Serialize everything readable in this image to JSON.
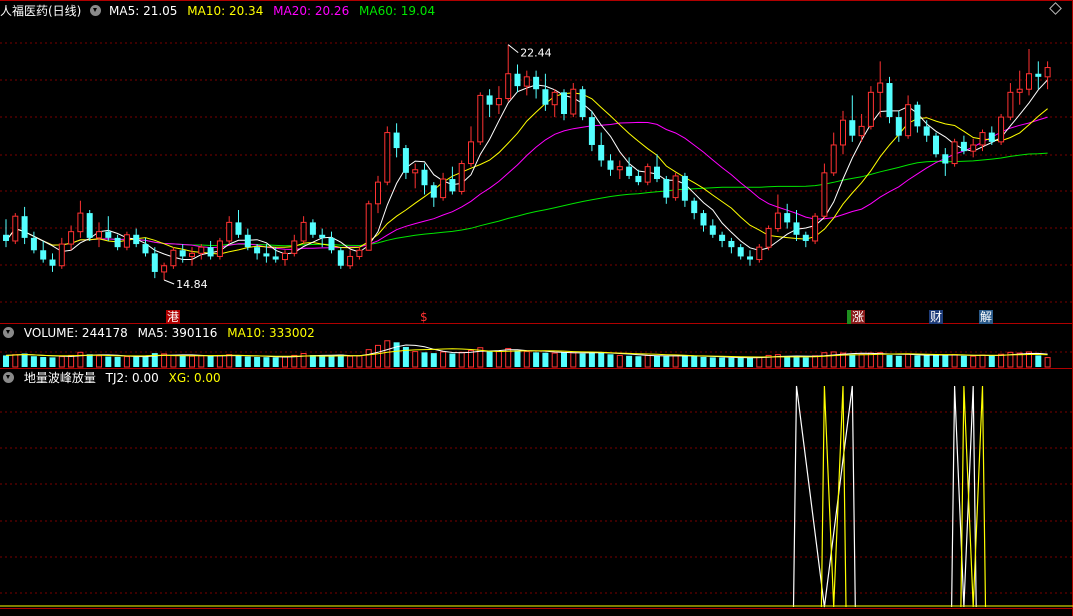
{
  "main_header": {
    "title": "人福医药(日线)",
    "ma5": "MA5: 21.05",
    "ma10": "MA10: 20.34",
    "ma20": "MA20: 20.26",
    "ma60": "MA60: 19.04"
  },
  "volume_header": {
    "label": "VOLUME: 244178",
    "ma5": "MA5: 390116",
    "ma10": "MA10: 333002"
  },
  "indicator_header": {
    "name": "地量波峰放量",
    "tj2": "TJ2: 0.00",
    "xg": "XG: 0.00"
  },
  "event_labels": {
    "e1": "港",
    "e2": "$",
    "e3": "涨",
    "e4": "财",
    "e5": "解"
  },
  "colors": {
    "up": "#ff3232",
    "down": "#54ffff",
    "ma5": "#ffffff",
    "ma10": "#ffff00",
    "ma20": "#ff00ff",
    "ma60": "#00e600",
    "grid": "#7a0000",
    "tj2": "#ffffff",
    "xg": "#ffff00"
  },
  "chart_data": [
    {
      "type": "candlestick",
      "ohlc": [
        [
          16.3,
          16.8,
          15.9,
          16.1
        ],
        [
          16.1,
          17.0,
          16.0,
          16.9
        ],
        [
          16.9,
          17.2,
          16.0,
          16.2
        ],
        [
          16.2,
          16.4,
          15.7,
          15.8
        ],
        [
          15.8,
          16.1,
          15.4,
          15.5
        ],
        [
          15.5,
          15.7,
          15.1,
          15.3
        ],
        [
          15.3,
          16.2,
          15.2,
          16.0
        ],
        [
          16.0,
          16.6,
          15.8,
          16.4
        ],
        [
          16.4,
          17.4,
          16.2,
          17.0
        ],
        [
          17.0,
          17.1,
          16.1,
          16.2
        ],
        [
          16.2,
          16.7,
          15.9,
          16.4
        ],
        [
          16.4,
          16.9,
          16.1,
          16.2
        ],
        [
          16.2,
          16.3,
          15.8,
          15.9
        ],
        [
          15.9,
          16.4,
          15.8,
          16.3
        ],
        [
          16.3,
          16.5,
          15.9,
          16.0
        ],
        [
          16.0,
          16.2,
          15.6,
          15.7
        ],
        [
          15.7,
          15.9,
          14.9,
          15.1
        ],
        [
          15.1,
          15.4,
          14.84,
          15.3
        ],
        [
          15.3,
          15.9,
          15.2,
          15.8
        ],
        [
          15.8,
          16.0,
          15.4,
          15.6
        ],
        [
          15.6,
          15.9,
          15.3,
          15.7
        ],
        [
          15.7,
          16.0,
          15.5,
          15.9
        ],
        [
          15.9,
          16.1,
          15.5,
          15.6
        ],
        [
          15.6,
          16.2,
          15.5,
          16.1
        ],
        [
          16.1,
          16.9,
          16.0,
          16.7
        ],
        [
          16.7,
          17.1,
          16.2,
          16.3
        ],
        [
          16.3,
          16.5,
          15.8,
          15.9
        ],
        [
          15.9,
          16.0,
          15.5,
          15.7
        ],
        [
          15.7,
          16.0,
          15.4,
          15.6
        ],
        [
          15.6,
          15.9,
          15.4,
          15.5
        ],
        [
          15.5,
          15.8,
          15.3,
          15.7
        ],
        [
          15.7,
          16.3,
          15.6,
          16.1
        ],
        [
          16.1,
          16.9,
          16.0,
          16.7
        ],
        [
          16.7,
          16.8,
          16.2,
          16.3
        ],
        [
          16.3,
          16.5,
          15.9,
          16.2
        ],
        [
          16.2,
          16.4,
          15.7,
          15.8
        ],
        [
          15.8,
          15.9,
          15.2,
          15.3
        ],
        [
          15.3,
          15.8,
          15.2,
          15.6
        ],
        [
          15.6,
          15.9,
          15.5,
          15.8
        ],
        [
          15.8,
          17.4,
          15.8,
          17.3
        ],
        [
          17.3,
          18.2,
          17.0,
          18.0
        ],
        [
          18.0,
          19.8,
          17.9,
          19.6
        ],
        [
          19.6,
          19.9,
          18.8,
          19.1
        ],
        [
          19.1,
          19.2,
          18.1,
          18.3
        ],
        [
          18.3,
          18.6,
          17.8,
          18.4
        ],
        [
          18.4,
          18.6,
          17.6,
          17.9
        ],
        [
          17.9,
          18.0,
          17.2,
          17.5
        ],
        [
          17.5,
          18.3,
          17.4,
          18.1
        ],
        [
          18.1,
          18.5,
          17.6,
          17.7
        ],
        [
          17.7,
          18.7,
          17.6,
          18.6
        ],
        [
          18.6,
          19.8,
          18.5,
          19.3
        ],
        [
          19.3,
          20.9,
          19.2,
          20.8
        ],
        [
          20.8,
          21.0,
          20.1,
          20.5
        ],
        [
          20.5,
          21.1,
          20.2,
          20.7
        ],
        [
          20.7,
          22.44,
          20.6,
          21.5
        ],
        [
          21.5,
          21.8,
          20.9,
          21.1
        ],
        [
          21.1,
          21.6,
          20.8,
          21.4
        ],
        [
          21.4,
          21.6,
          20.7,
          21.0
        ],
        [
          21.0,
          21.5,
          20.3,
          20.5
        ],
        [
          20.5,
          21.0,
          20.1,
          20.9
        ],
        [
          20.9,
          21.0,
          20.0,
          20.2
        ],
        [
          20.2,
          21.2,
          20.1,
          21.0
        ],
        [
          21.0,
          21.1,
          20.0,
          20.1
        ],
        [
          20.1,
          20.3,
          19.0,
          19.2
        ],
        [
          19.2,
          19.6,
          18.5,
          18.7
        ],
        [
          18.7,
          18.9,
          18.2,
          18.4
        ],
        [
          18.4,
          18.7,
          18.1,
          18.5
        ],
        [
          18.5,
          18.8,
          18.1,
          18.2
        ],
        [
          18.2,
          18.4,
          17.9,
          18.0
        ],
        [
          18.0,
          18.6,
          17.9,
          18.5
        ],
        [
          18.5,
          18.9,
          18.0,
          18.1
        ],
        [
          18.1,
          18.2,
          17.3,
          17.5
        ],
        [
          17.5,
          18.3,
          17.4,
          18.2
        ],
        [
          18.2,
          18.3,
          17.2,
          17.4
        ],
        [
          17.4,
          17.5,
          16.8,
          17.0
        ],
        [
          17.0,
          17.1,
          16.4,
          16.6
        ],
        [
          16.6,
          16.8,
          16.2,
          16.3
        ],
        [
          16.3,
          16.4,
          15.9,
          16.1
        ],
        [
          16.1,
          16.2,
          15.7,
          15.9
        ],
        [
          15.9,
          16.0,
          15.5,
          15.6
        ],
        [
          15.6,
          15.8,
          15.3,
          15.5
        ],
        [
          15.5,
          16.0,
          15.4,
          15.9
        ],
        [
          15.9,
          16.6,
          15.8,
          16.5
        ],
        [
          16.5,
          17.6,
          16.4,
          17.0
        ],
        [
          17.0,
          17.3,
          16.5,
          16.7
        ],
        [
          16.7,
          17.1,
          16.1,
          16.3
        ],
        [
          16.3,
          16.4,
          15.9,
          16.1
        ],
        [
          16.1,
          17.0,
          16.0,
          16.9
        ],
        [
          16.9,
          18.6,
          16.8,
          18.3
        ],
        [
          18.3,
          19.6,
          18.2,
          19.2
        ],
        [
          19.2,
          20.3,
          18.9,
          20.0
        ],
        [
          20.0,
          20.8,
          19.3,
          19.5
        ],
        [
          19.5,
          20.2,
          19.3,
          19.8
        ],
        [
          19.8,
          21.1,
          19.7,
          20.9
        ],
        [
          20.9,
          21.9,
          20.1,
          21.2
        ],
        [
          21.2,
          21.4,
          19.9,
          20.1
        ],
        [
          20.1,
          20.3,
          19.3,
          19.5
        ],
        [
          19.5,
          20.8,
          19.4,
          20.5
        ],
        [
          20.5,
          20.6,
          19.6,
          19.8
        ],
        [
          19.8,
          20.0,
          19.3,
          19.5
        ],
        [
          19.5,
          19.6,
          18.8,
          18.9
        ],
        [
          18.9,
          19.1,
          18.2,
          18.6
        ],
        [
          18.6,
          19.4,
          18.5,
          19.3
        ],
        [
          19.3,
          19.5,
          18.9,
          19.0
        ],
        [
          19.0,
          19.4,
          18.8,
          19.2
        ],
        [
          19.2,
          19.7,
          19.0,
          19.6
        ],
        [
          19.6,
          19.8,
          19.2,
          19.3
        ],
        [
          19.3,
          20.2,
          19.2,
          20.1
        ],
        [
          20.1,
          21.2,
          20.0,
          20.9
        ],
        [
          20.9,
          21.6,
          20.5,
          21.0
        ],
        [
          21.0,
          22.3,
          20.8,
          21.5
        ],
        [
          21.5,
          21.9,
          21.0,
          21.4
        ],
        [
          21.4,
          21.9,
          21.0,
          21.7
        ]
      ],
      "ylim": [
        14.0,
        23.3
      ],
      "annotations": [
        {
          "label": "22.44",
          "price": 22.44,
          "index": 54
        },
        {
          "label": "14.84",
          "price": 14.84,
          "index": 17
        }
      ]
    },
    {
      "type": "bar",
      "series": [
        {
          "values": [
            300000,
            320000,
            350000,
            280000,
            260000,
            250000,
            270000,
            300000,
            380000,
            330000,
            290000,
            270000,
            260000,
            270000,
            265000,
            280000,
            360000,
            340000,
            300000,
            290000,
            280000,
            290000,
            285000,
            300000,
            320000,
            290000,
            270000,
            260000,
            255000,
            250000,
            260000,
            300000,
            350000,
            310000,
            280000,
            290000,
            320000,
            280000,
            290000,
            450000,
            560000,
            680000,
            640000,
            520000,
            400000,
            380000,
            360000,
            390000,
            350000,
            380000,
            430000,
            500000,
            420000,
            400000,
            480000,
            430000,
            400000,
            380000,
            370000,
            360000,
            380000,
            370000,
            350000,
            380000,
            390000,
            330000,
            300000,
            290000,
            280000,
            300000,
            290000,
            280000,
            290000,
            300000,
            280000,
            260000,
            250000,
            245000,
            240000,
            235000,
            240000,
            260000,
            300000,
            320000,
            280000,
            260000,
            250000,
            290000,
            370000,
            390000,
            360000,
            330000,
            320000,
            360000,
            370000,
            310000,
            290000,
            330000,
            300000,
            310000,
            320000,
            300000,
            320000,
            290000,
            280000,
            310000,
            290000,
            330000,
            380000,
            360000,
            390000,
            300000,
            244178
          ]
        }
      ],
      "ylim": [
        0,
        700000
      ]
    },
    {
      "type": "line",
      "series": [
        {
          "name": "TJ2",
          "spikes": [
            {
              "from": 85,
              "to": 91
            },
            {
              "from": 102,
              "to": 104
            }
          ]
        },
        {
          "name": "XG",
          "spikes": [
            {
              "from": 88,
              "to": 90
            },
            {
              "from": 103,
              "to": 105
            }
          ]
        }
      ],
      "ylim": [
        0,
        1
      ]
    }
  ]
}
